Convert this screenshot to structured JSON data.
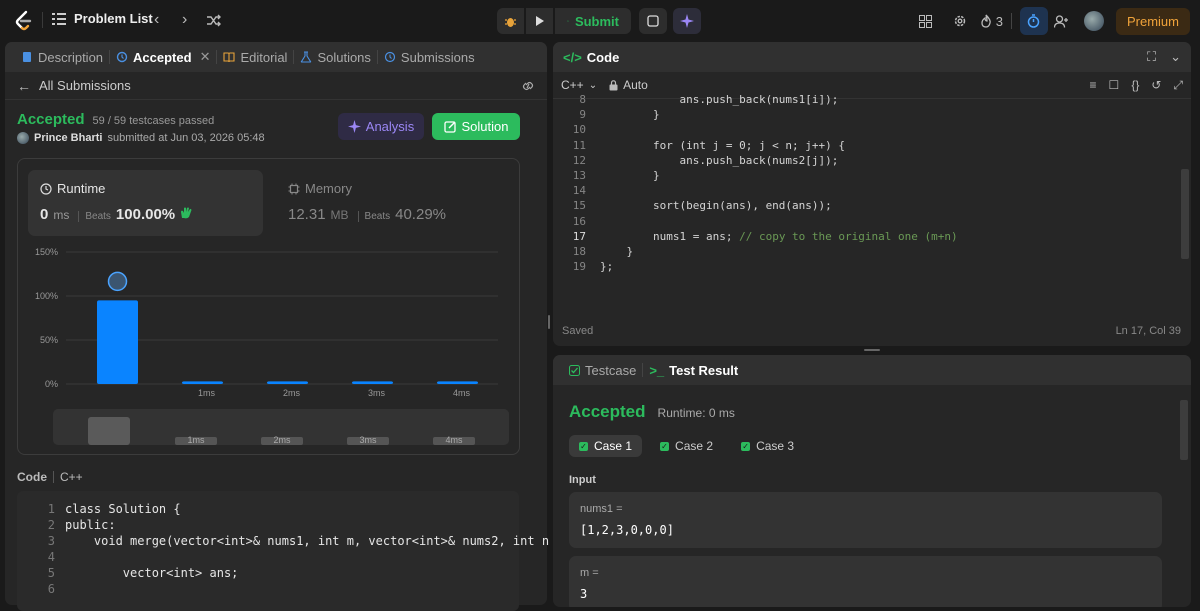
{
  "topbar": {
    "problem_list": "Problem List",
    "submit": "Submit",
    "streak": "3",
    "premium": "Premium",
    "accent": "#2cbb5d",
    "premium_color": "#f0a33a"
  },
  "left": {
    "tabs": {
      "description": "Description",
      "accepted": "Accepted",
      "editorial": "Editorial",
      "solutions": "Solutions",
      "submissions": "Submissions"
    },
    "back": "All Submissions",
    "status": "Accepted",
    "testcases": "59 / 59 testcases passed",
    "user": "Prince Bharti",
    "submitted_at": "submitted at Jun 03, 2026 05:48",
    "analysis": "Analysis",
    "solution": "Solution",
    "runtime": {
      "label": "Runtime",
      "value": "0",
      "unit": "ms",
      "beats_label": "Beats",
      "beats": "100.00%"
    },
    "memory": {
      "label": "Memory",
      "value": "12.31",
      "unit": "MB",
      "beats_label": "Beats",
      "beats": "40.29%"
    },
    "code_header": "Code",
    "code_lang": "C++",
    "code_lines": [
      {
        "n": "1",
        "t": "class Solution {"
      },
      {
        "n": "2",
        "t": "public:"
      },
      {
        "n": "3",
        "t": "    void merge(vector<int>& nums1, int m, vector<int>& nums2, int n"
      },
      {
        "n": "4",
        "t": ""
      },
      {
        "n": "5",
        "t": "        vector<int> ans;"
      },
      {
        "n": "6",
        "t": ""
      }
    ]
  },
  "chart_data": {
    "type": "bar",
    "categories": [
      "",
      "1ms",
      "2ms",
      "3ms",
      "4ms"
    ],
    "values": [
      95,
      3,
      3,
      3,
      3
    ],
    "yticks": [
      "150%",
      "100%",
      "50%",
      "0%"
    ],
    "ylim": [
      0,
      150
    ],
    "overview_labels": [
      "1ms",
      "2ms",
      "3ms",
      "4ms"
    ],
    "bar_color": "#0a84ff"
  },
  "editor": {
    "title": "Code",
    "lang": "C++",
    "mode": "Auto",
    "saved": "Saved",
    "cursor": "Ln 17, Col 39",
    "lines": [
      {
        "n": "8",
        "t": "            ans.push_back(nums1[i]);"
      },
      {
        "n": "9",
        "t": "        }"
      },
      {
        "n": "10",
        "t": ""
      },
      {
        "n": "11",
        "t": "        for (int j = 0; j < n; j++) {"
      },
      {
        "n": "12",
        "t": "            ans.push_back(nums2[j]);"
      },
      {
        "n": "13",
        "t": "        }"
      },
      {
        "n": "14",
        "t": ""
      },
      {
        "n": "15",
        "t": "        sort(begin(ans), end(ans));"
      },
      {
        "n": "16",
        "t": ""
      },
      {
        "n": "17",
        "t": "        nums1 = ans; ",
        "c": "// copy to the original one (m+n)"
      },
      {
        "n": "18",
        "t": "    }"
      },
      {
        "n": "19",
        "t": "};"
      }
    ]
  },
  "result": {
    "tab_testcase": "Testcase",
    "tab_result": "Test Result",
    "status": "Accepted",
    "runtime": "Runtime: 0 ms",
    "cases": [
      "Case 1",
      "Case 2",
      "Case 3"
    ],
    "input_label": "Input",
    "inputs": [
      {
        "name": "nums1 =",
        "value": "[1,2,3,0,0,0]"
      },
      {
        "name": "m =",
        "value": "3"
      }
    ]
  }
}
